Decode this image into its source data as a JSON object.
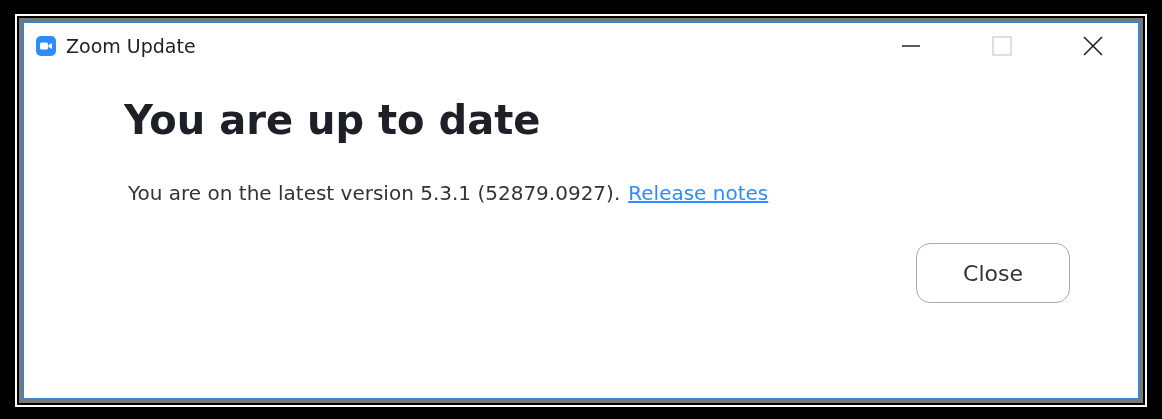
{
  "window": {
    "title": "Zoom Update",
    "controls": [
      {
        "kind": "minimize",
        "disabled": false
      },
      {
        "kind": "maximize",
        "disabled": true
      },
      {
        "kind": "close",
        "disabled": false
      }
    ]
  },
  "heading": "You are up to date",
  "message": {
    "text": "You are on the latest version 5.3.1 (52879.0927).",
    "link": "Release notes"
  },
  "buttons": [
    "Close"
  ]
}
